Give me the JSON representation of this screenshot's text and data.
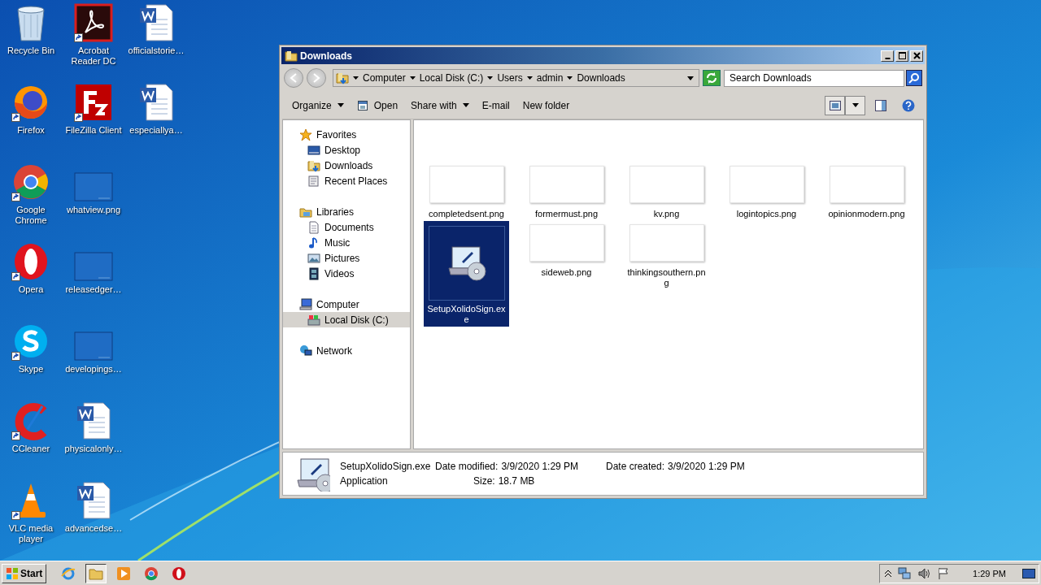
{
  "desktop": {
    "icons": [
      {
        "label": "Recycle Bin",
        "kind": "recycle",
        "shortcut": false
      },
      {
        "label": "Firefox",
        "kind": "firefox",
        "shortcut": true
      },
      {
        "label": "Google Chrome",
        "kind": "chrome",
        "shortcut": true
      },
      {
        "label": "Opera",
        "kind": "opera",
        "shortcut": true
      },
      {
        "label": "Skype",
        "kind": "skype",
        "shortcut": true
      },
      {
        "label": "CCleaner",
        "kind": "ccleaner",
        "shortcut": true
      },
      {
        "label": "VLC media player",
        "kind": "vlc",
        "shortcut": true
      },
      {
        "label": "Acrobat Reader DC",
        "kind": "acrobat",
        "shortcut": true
      },
      {
        "label": "FileZilla Client",
        "kind": "filezilla",
        "shortcut": true
      },
      {
        "label": "whatview.png",
        "kind": "image",
        "shortcut": false
      },
      {
        "label": "releasedger…",
        "kind": "image",
        "shortcut": false
      },
      {
        "label": "developings…",
        "kind": "image",
        "shortcut": false
      },
      {
        "label": "physicalonly…",
        "kind": "word",
        "shortcut": false
      },
      {
        "label": "advancedse…",
        "kind": "word",
        "shortcut": false
      },
      {
        "label": "officialstorie…",
        "kind": "word",
        "shortcut": false
      },
      {
        "label": "especiallya…",
        "kind": "word",
        "shortcut": false
      }
    ]
  },
  "window": {
    "title": "Downloads",
    "address": {
      "crumbs": [
        "Computer",
        "Local Disk (C:)",
        "Users",
        "admin",
        "Downloads"
      ]
    },
    "search": {
      "placeholder": "Search Downloads"
    },
    "toolbar": [
      {
        "label": "Organize",
        "kind": "menu"
      },
      {
        "label": "Open",
        "kind": "open"
      },
      {
        "label": "Share with",
        "kind": "menu"
      },
      {
        "label": "E-mail",
        "kind": "plain"
      },
      {
        "label": "New folder",
        "kind": "plain"
      }
    ],
    "sidebar": {
      "items": [
        {
          "label": "Favorites",
          "kind": "star",
          "selected": false,
          "children": [
            {
              "label": "Desktop",
              "kind": "desktop",
              "selected": false
            },
            {
              "label": "Downloads",
              "kind": "downloads",
              "selected": false
            },
            {
              "label": "Recent Places",
              "kind": "recent",
              "selected": false
            }
          ]
        },
        {
          "label": "Libraries",
          "kind": "libraries",
          "selected": false,
          "children": [
            {
              "label": "Documents",
              "kind": "documents",
              "selected": false
            },
            {
              "label": "Music",
              "kind": "music",
              "selected": false
            },
            {
              "label": "Pictures",
              "kind": "pictures",
              "selected": false
            },
            {
              "label": "Videos",
              "kind": "videos",
              "selected": false
            }
          ]
        },
        {
          "label": "Computer",
          "kind": "computer",
          "selected": false,
          "children": [
            {
              "label": "Local Disk (C:)",
              "kind": "disk",
              "selected": true
            }
          ]
        },
        {
          "label": "Network",
          "kind": "network",
          "selected": false
        }
      ]
    },
    "files": [
      {
        "name": "completedsent.png",
        "kind": "image",
        "selected": false
      },
      {
        "name": "formermust.png",
        "kind": "image",
        "selected": false
      },
      {
        "name": "kv.png",
        "kind": "image",
        "selected": false
      },
      {
        "name": "logintopics.png",
        "kind": "image",
        "selected": false
      },
      {
        "name": "opinionmodern.png",
        "kind": "image",
        "selected": false
      },
      {
        "name": "SetupXolidoSign.exe",
        "kind": "installer",
        "selected": true
      },
      {
        "name": "sideweb.png",
        "kind": "image",
        "selected": false
      },
      {
        "name": "thinkingsouthern.png",
        "kind": "image",
        "selected": false
      }
    ],
    "details": {
      "name": "SetupXolidoSign.exe",
      "type": "Application",
      "fields": [
        {
          "label": "Date modified:",
          "value": "3/9/2020 1:29 PM"
        },
        {
          "label": "Date created:",
          "value": "3/9/2020 1:29 PM"
        },
        {
          "label": "Size:",
          "value": "18.7 MB"
        }
      ]
    }
  },
  "taskbar": {
    "start": "Start",
    "apps": [
      {
        "kind": "ie",
        "selected": false
      },
      {
        "kind": "explorer",
        "selected": true
      },
      {
        "kind": "media",
        "selected": false
      },
      {
        "kind": "chrome",
        "selected": false
      },
      {
        "kind": "opera",
        "selected": false
      }
    ],
    "clock": "1:29 PM"
  }
}
